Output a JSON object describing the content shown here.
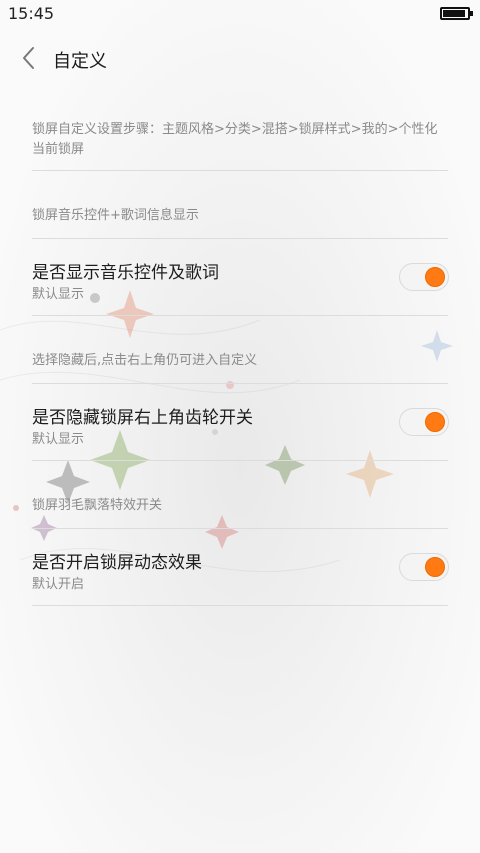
{
  "status_bar": {
    "time": "15:45"
  },
  "header": {
    "title": "自定义"
  },
  "notes": {
    "instructions_line1": "锁屏自定义设置步骤：主题风格>分类>混搭>锁屏样式>我的>个性化",
    "instructions_line2": "当前锁屏",
    "section_music": "锁屏音乐控件+歌词信息显示",
    "section_gear": "选择隐藏后,点击右上角仍可进入自定义",
    "section_feather": "锁屏羽毛飘落特效开关"
  },
  "settings": [
    {
      "title": "是否显示音乐控件及歌词",
      "subtitle": "默认显示",
      "enabled": true
    },
    {
      "title": "是否隐藏锁屏右上角齿轮开关",
      "subtitle": "默认显示",
      "enabled": true
    },
    {
      "title": "是否开启锁屏动态效果",
      "subtitle": "默认开启",
      "enabled": true
    }
  ],
  "colors": {
    "accent": "#ff7a12",
    "divider": "#dcdcdc",
    "note_text": "#8a8a8a"
  }
}
